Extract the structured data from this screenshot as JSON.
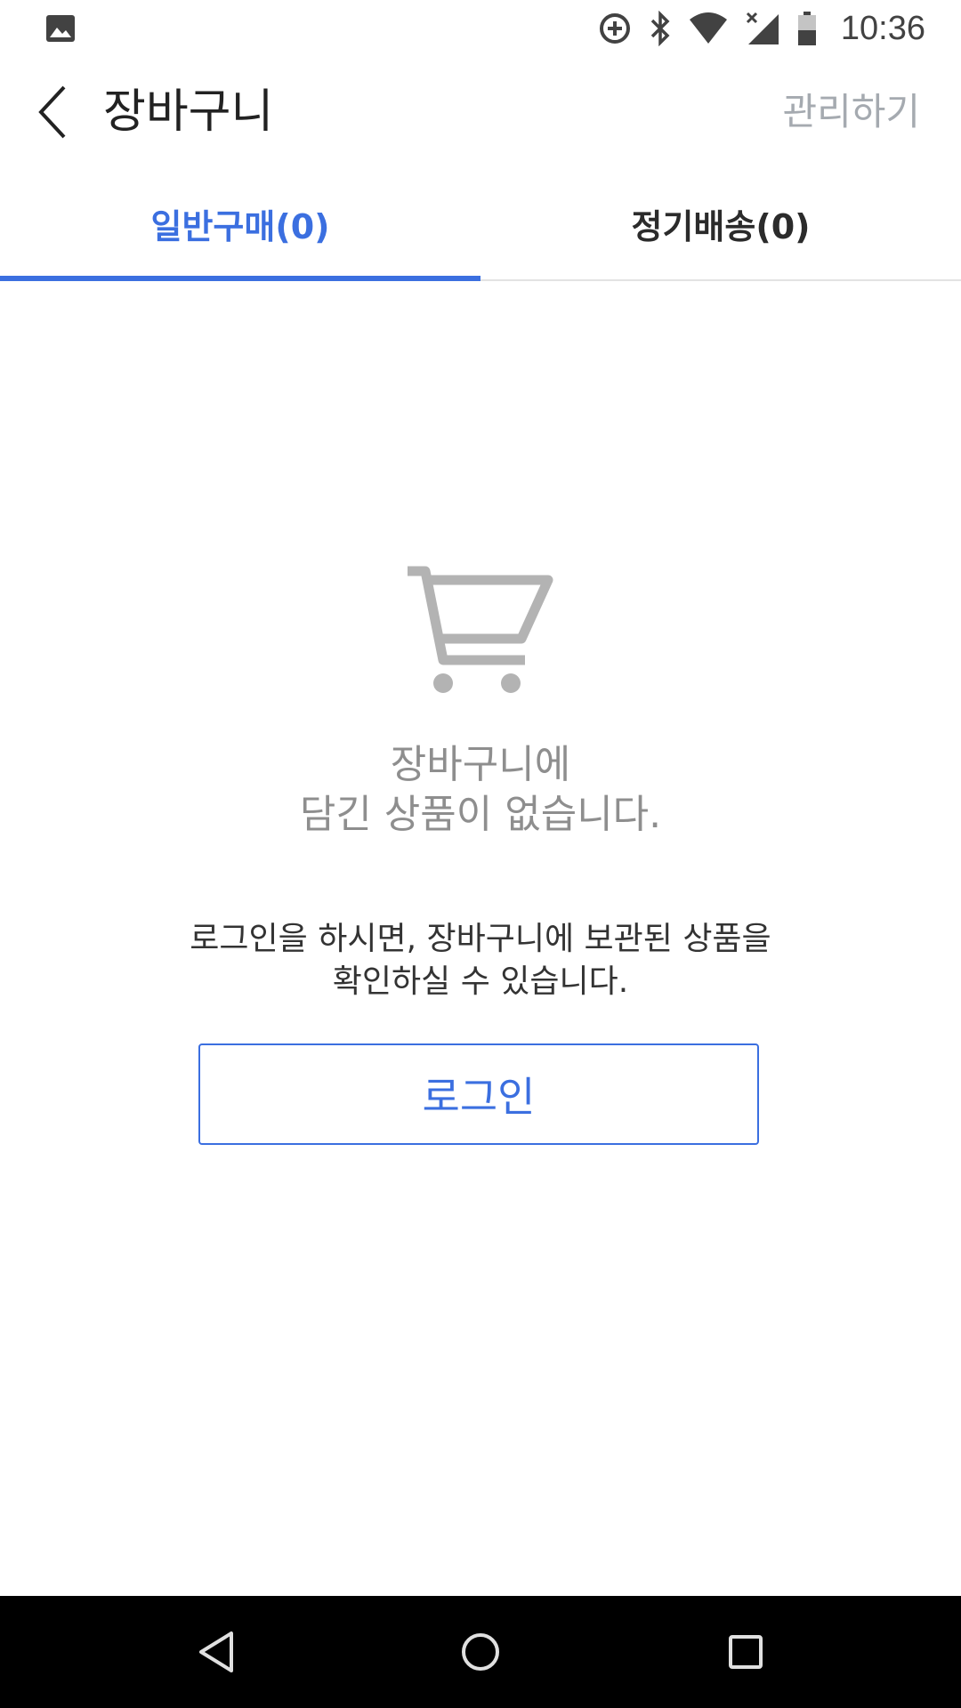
{
  "status_bar": {
    "time": "10:36",
    "icons": [
      "gallery-icon",
      "data-saver-icon",
      "bluetooth-icon",
      "wifi-icon",
      "no-signal-icon",
      "battery-icon"
    ]
  },
  "app_bar": {
    "title": "장바구니",
    "manage_label": "관리하기"
  },
  "tabs": [
    {
      "label": "일반구매(0)",
      "active": true
    },
    {
      "label": "정기배송(0)",
      "active": false
    }
  ],
  "empty_state": {
    "icon": "cart-icon",
    "line1": "장바구니에",
    "line2": "담긴 상품이 없습니다.",
    "hint_line1": "로그인을 하시면, 장바구니에 보관된 상품을",
    "hint_line2": "확인하실 수 있습니다.",
    "login_label": "로그인"
  },
  "nav_bar": {
    "icons": [
      "back-triangle-icon",
      "home-circle-icon",
      "recents-square-icon"
    ]
  },
  "colors": {
    "accent": "#3b6fe0",
    "muted_text": "#8e8e8e",
    "manage_text": "#a5aab0",
    "cart_icon": "#b3b3b3"
  }
}
